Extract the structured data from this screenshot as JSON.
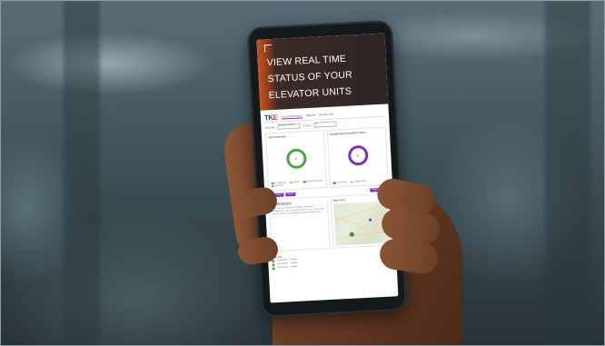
{
  "hero": {
    "lines": [
      "VIEW REAL TIME",
      "STATUS OF YOUR",
      "ELEVATOR UNITS"
    ]
  },
  "app": {
    "logo_main": "TK",
    "logo_accent": "E",
    "nav": [
      "Current Overview",
      "Reports",
      "Service Info"
    ],
    "filters": [
      {
        "label": "Select By",
        "value": "Building Location"
      },
      {
        "label": "Location",
        "value": "All"
      }
    ],
    "cards": [
      {
        "title": "Unit Overview",
        "legend": [
          "In Operation",
          "Alarms",
          "Service Requests",
          "Unknown"
        ]
      },
      {
        "title": "Unplanned Downtime Hours",
        "legend": [
          "Total Hours",
          "Tracked Units"
        ]
      }
    ],
    "buttons": {
      "left1": "Report Issue",
      "left2": "Details",
      "right": "Request Service"
    },
    "notifications": {
      "title": "Notifications",
      "body": "Your units are operating normally. Scheduled maintenance is upcoming for selected units. Check open service requests and equipment status updates here."
    },
    "map": {
      "title": "Map View"
    },
    "table": {
      "title": "Unit List",
      "rows": [
        [
          "Operational",
          "Details"
        ],
        [
          "Operational",
          "Details"
        ],
        [
          "Operational",
          "Details"
        ]
      ]
    }
  },
  "colors": {
    "accent": "#7b2fbf",
    "status_green": "#4aa54a",
    "brand_orange": "#e8451e",
    "brand_blue": "#1f4ea0"
  }
}
